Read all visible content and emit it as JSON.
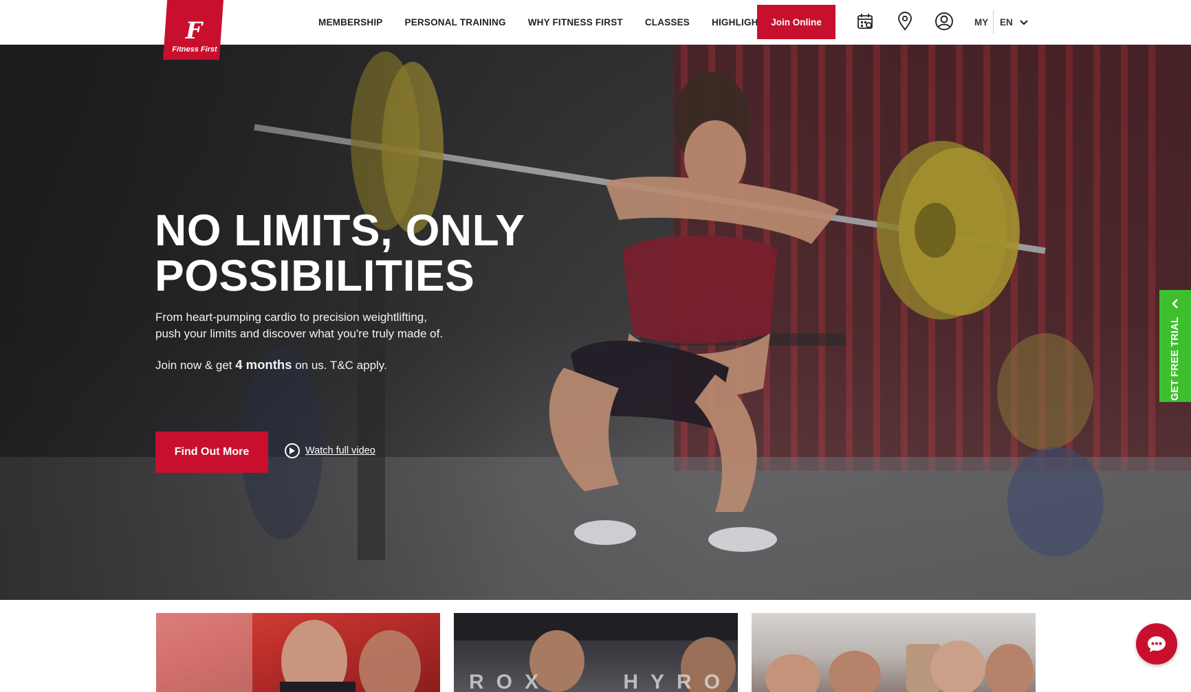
{
  "brand": {
    "name": "Fitness First",
    "accent_color": "#c8102e",
    "trial_color": "#3fbf2e"
  },
  "nav": {
    "items": [
      {
        "label": "MEMBERSHIP"
      },
      {
        "label": "PERSONAL TRAINING"
      },
      {
        "label": "WHY FITNESS FIRST"
      },
      {
        "label": "CLASSES"
      },
      {
        "label": "HIGHLIGHTS"
      }
    ],
    "join_label": "Join Online",
    "icons": [
      "calendar-icon",
      "location-pin-icon",
      "user-account-icon"
    ],
    "country": "MY",
    "language": "EN"
  },
  "hero": {
    "title_line1": "NO LIMITS, ONLY",
    "title_line2": "POSSIBILITIES",
    "description_line1": "From heart-pumping cardio to precision weightlifting,",
    "description_line2": "push your limits and discover what you're truly made of.",
    "offer_prefix": "Join now & get ",
    "offer_highlight": "4 months",
    "offer_suffix": " on us. T&C apply.",
    "cta_label": "Find Out More",
    "video_label": "Watch full video"
  },
  "side_tab": {
    "label": "GET FREE TRIAL"
  },
  "cards": [
    {
      "name": "promo-card-1"
    },
    {
      "name": "promo-card-2",
      "overlay_text": "ROX    HYRO"
    },
    {
      "name": "promo-card-3"
    }
  ],
  "chat": {
    "icon": "chat-bubble-icon"
  }
}
